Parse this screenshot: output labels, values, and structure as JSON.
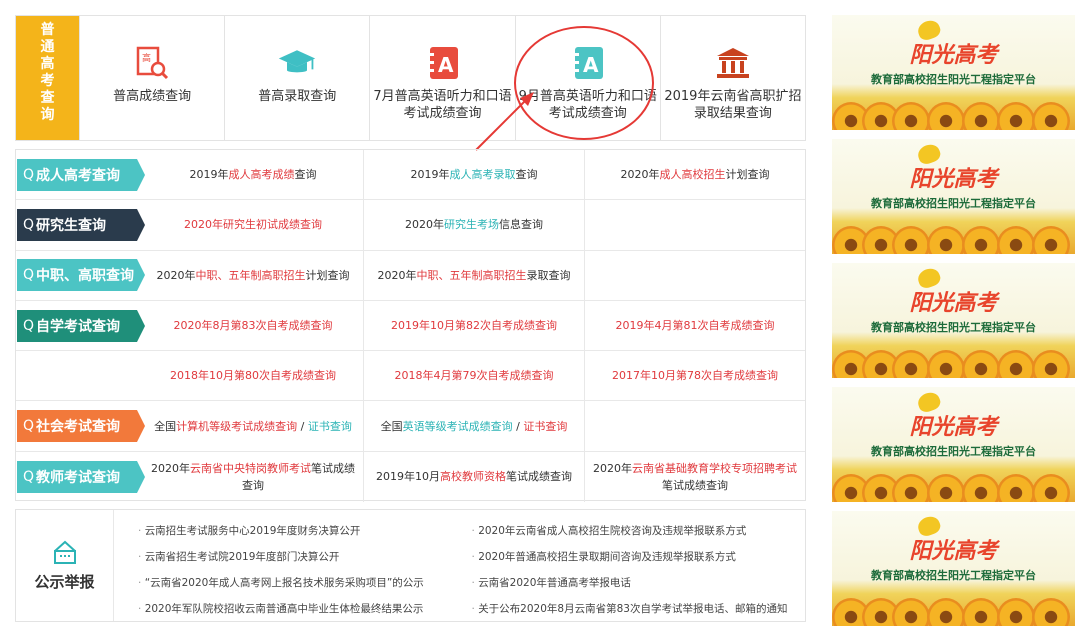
{
  "topbar": {
    "tag": [
      "普",
      "通",
      "高",
      "考",
      "查",
      "询"
    ],
    "items": [
      {
        "label": "普高成绩查询",
        "icon": "search-doc-icon"
      },
      {
        "label": "普高录取查询",
        "icon": "graduation-cap-icon"
      },
      {
        "label": "7月普高英语听力和口语考试成绩查询",
        "icon": "notebook-a-icon"
      },
      {
        "label": "9月普高英语听力和口语考试成绩查询",
        "icon": "notebook-a-icon"
      },
      {
        "label": "2019年云南省高职扩招录取结果查询",
        "icon": "institution-icon"
      }
    ]
  },
  "query_rows": [
    {
      "label": "成人高考查询",
      "color": "#4cc4c4",
      "cells": [
        [
          "2019年",
          "成人高考成绩",
          "查询"
        ],
        [
          "2019年",
          "成人高考录取",
          "查询"
        ],
        [
          "2020年",
          "成人高校招生",
          "计划查询"
        ]
      ]
    },
    {
      "label": "研究生查询",
      "color": "#2a3b4c",
      "cells": [
        [
          "",
          "2020年研究生初试成绩查询",
          ""
        ],
        [
          "2020年",
          "研究生考场",
          "信息查询"
        ],
        [
          "",
          "",
          ""
        ]
      ]
    },
    {
      "label": "中职、高职查询",
      "color": "#4cc4c4",
      "cells": [
        [
          "2020年",
          "中职、五年制高职招生",
          "计划查询"
        ],
        [
          "2020年",
          "中职、五年制高职招生",
          "录取查询"
        ],
        [
          "",
          "",
          ""
        ]
      ]
    },
    {
      "label": "自学考试查询",
      "color": "#1f8f7a",
      "cells": [
        [
          "",
          "2020年8月第83次自考成绩查询",
          ""
        ],
        [
          "",
          "2019年10月第82次自考成绩查询",
          ""
        ],
        [
          "",
          "2019年4月第81次自考成绩查询",
          ""
        ]
      ]
    },
    {
      "label": "",
      "color": "",
      "cells": [
        [
          "",
          "2018年10月第80次自考成绩查询",
          ""
        ],
        [
          "",
          "2018年4月第79次自考成绩查询",
          ""
        ],
        [
          "",
          "2017年10月第78次自考成绩查询",
          ""
        ]
      ]
    },
    {
      "label": "社会考试查询",
      "color": "#f2793b",
      "cells": [
        [
          "全国",
          "计算机等级考试成绩查询",
          " / ",
          "证书查询"
        ],
        [
          "全国",
          "英语等级考试成绩查询",
          " / ",
          "证书查询"
        ],
        [
          "",
          "",
          ""
        ]
      ]
    },
    {
      "label": "教师考试查询",
      "color": "#4cc4c4",
      "cells": [
        [
          "2020年",
          "云南省中央特岗教师考试",
          "笔试成绩查询"
        ],
        [
          "2019年10月",
          "高校教师资格",
          "笔试成绩查询"
        ],
        [
          "2020年",
          "云南省基础教育学校专项招聘考试",
          "笔试成绩查询"
        ]
      ]
    }
  ],
  "notice": {
    "title": "公示举报",
    "items": [
      "云南招生考试服务中心2019年度财务决算公开",
      "2020年云南省成人高校招生院校咨询及违规举报联系方式",
      "云南省招生考试院2019年度部门决算公开",
      "2020年普通高校招生录取期间咨询及违规举报联系方式",
      "“云南省2020年成人高考网上报名技术服务采购项目”的公示",
      "云南省2020年普通高考举报电话",
      "2020年军队院校招收云南普通高中毕业生体检最终结果公示",
      "关于公布2020年8月云南省第83次自学考试举报电话、邮箱的通知"
    ]
  },
  "banner": {
    "title": "阳光高考",
    "subtitle": "教育部高校招生阳光工程指定平台"
  },
  "colors": {
    "accent_yellow": "#f4b41a",
    "highlight_red": "#e0393d",
    "teal": "#2bb3b5"
  }
}
